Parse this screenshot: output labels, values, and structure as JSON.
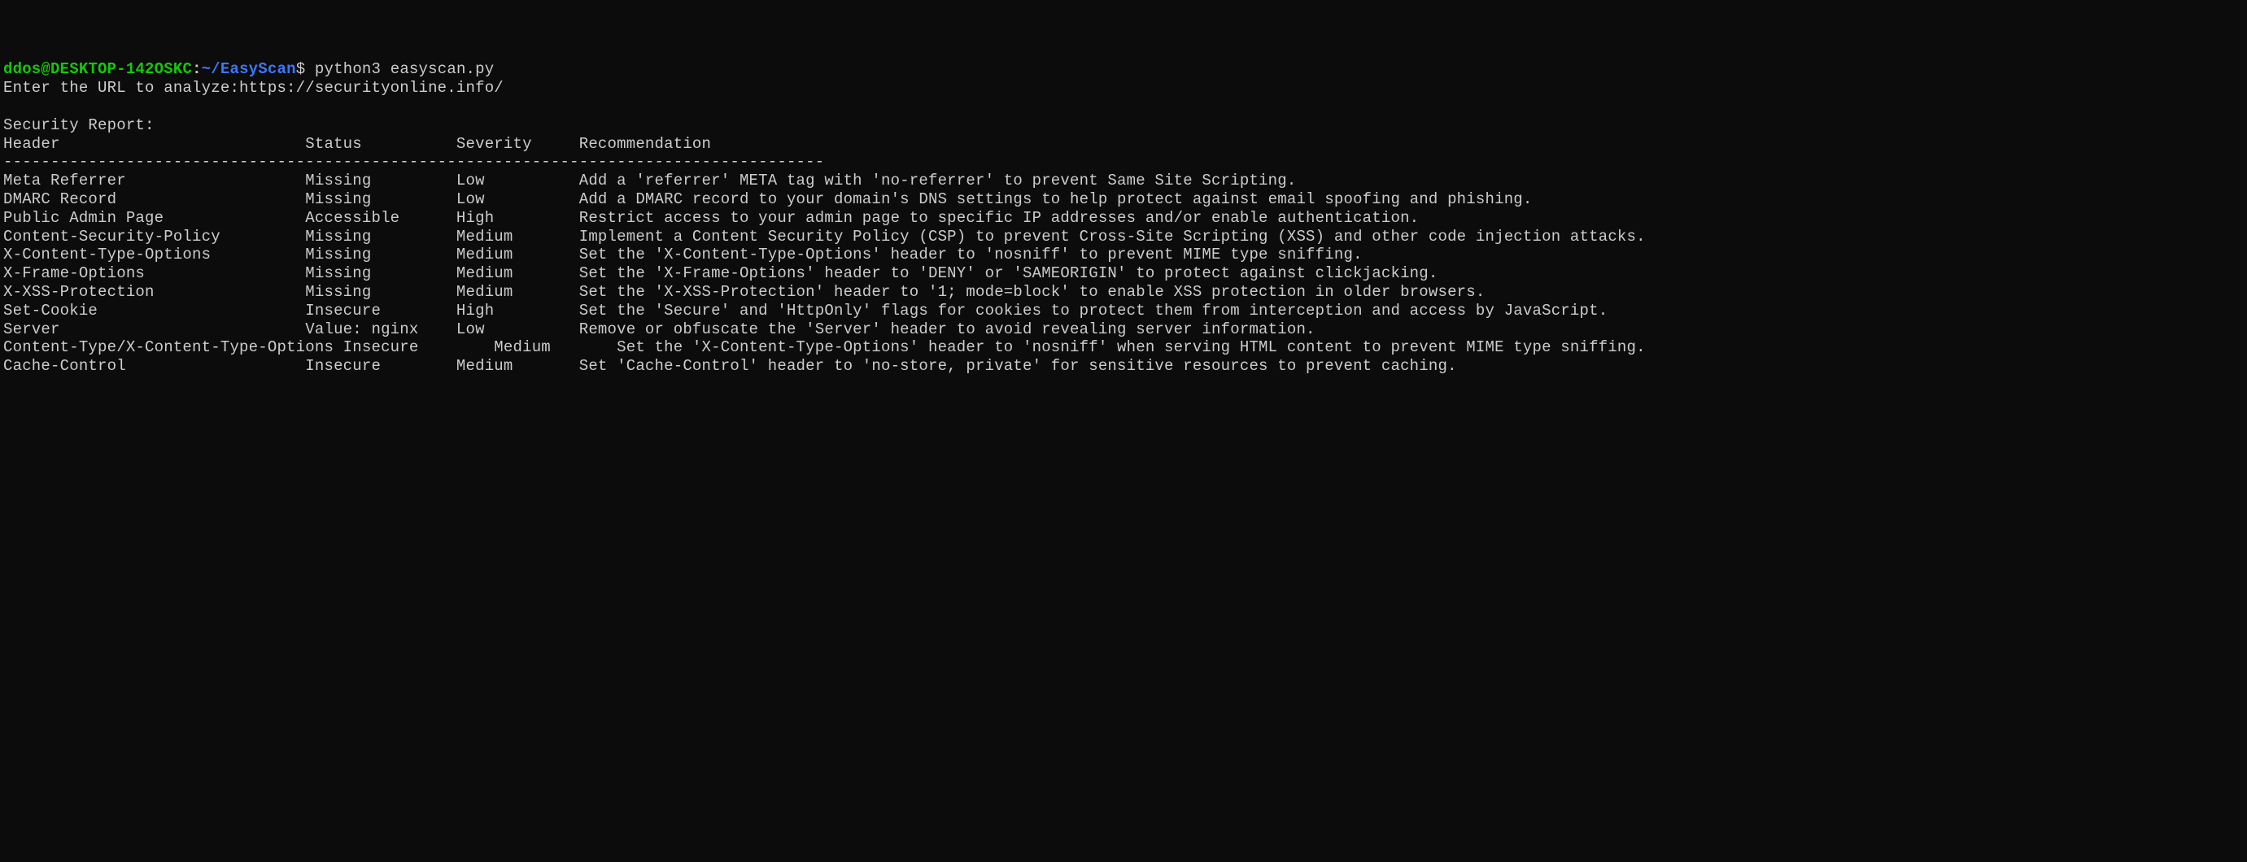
{
  "prompt": {
    "user": "ddos",
    "at": "@",
    "host": "DESKTOP-142OSKC",
    "colon": ":",
    "path": "~/EasyScan",
    "dollar": "$",
    "command": " python3 easyscan.py"
  },
  "input_prompt": "Enter the URL to analyze:",
  "input_url": "https://securityonline.info/",
  "blank": "",
  "report_title": "Security Report:",
  "columns_line": "Header                          Status          Severity     Recommendation",
  "divider": "---------------------------------------------------------------------------------------",
  "rows": [
    "Meta Referrer                   Missing         Low          Add a 'referrer' META tag with 'no-referrer' to prevent Same Site Scripting.",
    "DMARC Record                    Missing         Low          Add a DMARC record to your domain's DNS settings to help protect against email spoofing and phishing.",
    "Public Admin Page               Accessible      High         Restrict access to your admin page to specific IP addresses and/or enable authentication.",
    "Content-Security-Policy         Missing         Medium       Implement a Content Security Policy (CSP) to prevent Cross-Site Scripting (XSS) and other code injection attacks.",
    "X-Content-Type-Options          Missing         Medium       Set the 'X-Content-Type-Options' header to 'nosniff' to prevent MIME type sniffing.",
    "X-Frame-Options                 Missing         Medium       Set the 'X-Frame-Options' header to 'DENY' or 'SAMEORIGIN' to protect against clickjacking.",
    "X-XSS-Protection                Missing         Medium       Set the 'X-XSS-Protection' header to '1; mode=block' to enable XSS protection in older browsers.",
    "Set-Cookie                      Insecure        High         Set the 'Secure' and 'HttpOnly' flags for cookies to protect them from interception and access by JavaScript.",
    "Server                          Value: nginx    Low          Remove or obfuscate the 'Server' header to avoid revealing server information.",
    "Content-Type/X-Content-Type-Options Insecure        Medium       Set the 'X-Content-Type-Options' header to 'nosniff' when serving HTML content to prevent MIME type sniffing.",
    "Cache-Control                   Insecure        Medium       Set 'Cache-Control' header to 'no-store, private' for sensitive resources to prevent caching."
  ]
}
